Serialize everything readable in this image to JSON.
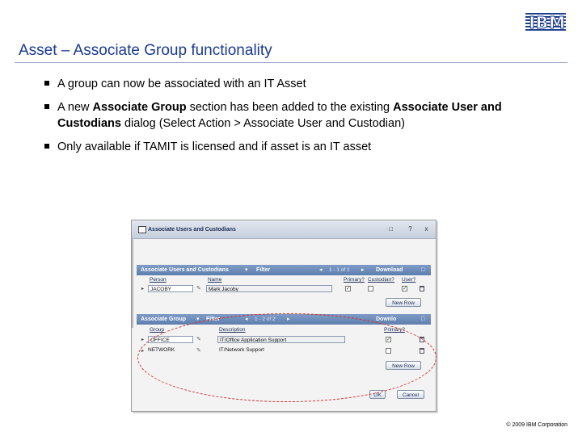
{
  "slide": {
    "logo_text": "IBM",
    "title": "Asset – Associate Group functionality",
    "bullets": [
      {
        "parts": [
          {
            "text": "A group can now be associated with an IT Asset",
            "bold": false
          }
        ]
      },
      {
        "parts": [
          {
            "text": "A new ",
            "bold": false
          },
          {
            "text": "Associate Group",
            "bold": true
          },
          {
            "text": " section has been added to the existing ",
            "bold": false
          },
          {
            "text": "Associate User and Custodians",
            "bold": true
          },
          {
            "text": " dialog (Select Action > Associate User and Custodian)",
            "bold": false
          }
        ]
      },
      {
        "parts": [
          {
            "text": "Only available if TAMIT is licensed and if asset is an IT asset",
            "bold": false
          }
        ]
      }
    ],
    "copyright": "© 2009 IBM Corporation"
  },
  "dialog": {
    "title": "Associate Users and Custodians",
    "title_buttons": [
      "?",
      "x"
    ],
    "users_section": {
      "header": "Associate Users and Custodians",
      "filter_label": "Filter",
      "count": "1 - 1 of 1",
      "download_label": "Download",
      "columns": [
        "Person",
        "Name",
        "Primary?",
        "Custodian?",
        "User?"
      ],
      "rows": [
        {
          "person": "JACOBY",
          "name": "Mark Jacoby",
          "primary": true,
          "custodian": false,
          "user": true
        }
      ],
      "new_row_label": "New Row"
    },
    "group_section": {
      "header": "Associate Group",
      "filter_label": "Filter",
      "count": "1 - 2 of 2",
      "download_label": "Downlo",
      "columns": [
        "Group",
        "Description",
        "Primary?"
      ],
      "rows": [
        {
          "group": "OFFICE",
          "description": "IT/Office Application Support",
          "primary": true
        },
        {
          "group": "NETWORK",
          "description": "IT/Network Support",
          "primary": false
        }
      ],
      "new_row_label": "New Row"
    },
    "ok_label": "OK",
    "cancel_label": "Cancel"
  },
  "colors": {
    "title_blue": "#1a3a8f",
    "section_header": "#6886b8",
    "highlight": "#d43030"
  }
}
